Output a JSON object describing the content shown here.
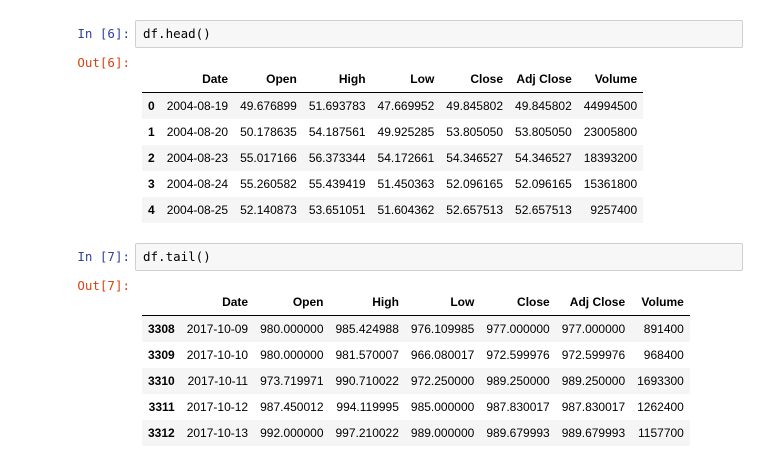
{
  "cells": [
    {
      "in_prompt": "In [6]:",
      "code": "df.head()",
      "out_prompt": "Out[6]:",
      "columns": [
        "",
        "Date",
        "Open",
        "High",
        "Low",
        "Close",
        "Adj Close",
        "Volume"
      ],
      "rows": [
        [
          "0",
          "2004-08-19",
          "49.676899",
          "51.693783",
          "47.669952",
          "49.845802",
          "49.845802",
          "44994500"
        ],
        [
          "1",
          "2004-08-20",
          "50.178635",
          "54.187561",
          "49.925285",
          "53.805050",
          "53.805050",
          "23005800"
        ],
        [
          "2",
          "2004-08-23",
          "55.017166",
          "56.373344",
          "54.172661",
          "54.346527",
          "54.346527",
          "18393200"
        ],
        [
          "3",
          "2004-08-24",
          "55.260582",
          "55.439419",
          "51.450363",
          "52.096165",
          "52.096165",
          "15361800"
        ],
        [
          "4",
          "2004-08-25",
          "52.140873",
          "53.651051",
          "51.604362",
          "52.657513",
          "52.657513",
          "9257400"
        ]
      ]
    },
    {
      "in_prompt": "In [7]:",
      "code": "df.tail()",
      "out_prompt": "Out[7]:",
      "columns": [
        "",
        "Date",
        "Open",
        "High",
        "Low",
        "Close",
        "Adj Close",
        "Volume"
      ],
      "rows": [
        [
          "3308",
          "2017-10-09",
          "980.000000",
          "985.424988",
          "976.109985",
          "977.000000",
          "977.000000",
          "891400"
        ],
        [
          "3309",
          "2017-10-10",
          "980.000000",
          "981.570007",
          "966.080017",
          "972.599976",
          "972.599976",
          "968400"
        ],
        [
          "3310",
          "2017-10-11",
          "973.719971",
          "990.710022",
          "972.250000",
          "989.250000",
          "989.250000",
          "1693300"
        ],
        [
          "3311",
          "2017-10-12",
          "987.450012",
          "994.119995",
          "985.000000",
          "987.830017",
          "987.830017",
          "1262400"
        ],
        [
          "3312",
          "2017-10-13",
          "992.000000",
          "997.210022",
          "989.000000",
          "989.679993",
          "989.679993",
          "1157700"
        ]
      ]
    }
  ]
}
